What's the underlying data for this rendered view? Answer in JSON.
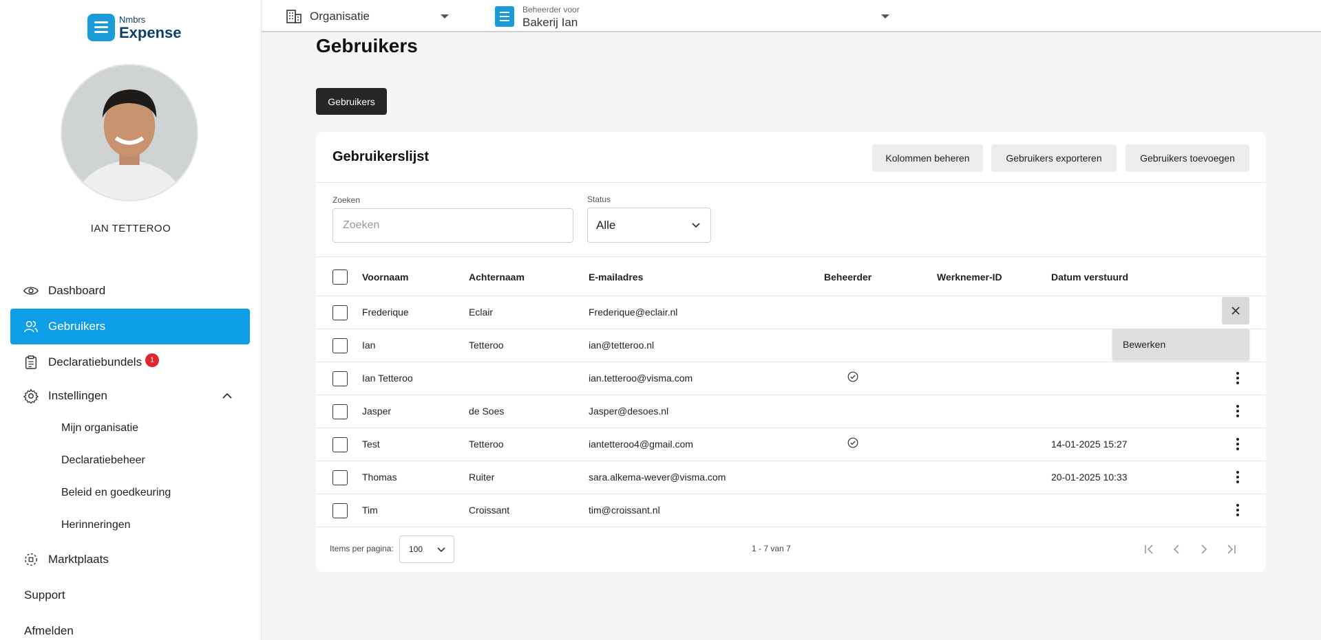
{
  "brand": {
    "line1": "Nmbrs",
    "line2": "Expense"
  },
  "user": {
    "name": "IAN TETTEROO"
  },
  "nav": {
    "items": [
      {
        "label": "Dashboard"
      },
      {
        "label": "Gebruikers"
      },
      {
        "label": "Declaratiebundels",
        "badge": "1"
      },
      {
        "label": "Instellingen"
      }
    ],
    "settings_sub": [
      "Mijn organisatie",
      "Declaratiebeheer",
      "Beleid en goedkeuring",
      "Herinneringen"
    ],
    "marketplace": "Marktplaats",
    "support": "Support",
    "logout": "Afmelden"
  },
  "topbar": {
    "org_label": "Organisatie",
    "admin_caption": "Beheerder voor",
    "admin_value": "Bakerij Ian"
  },
  "page": {
    "title": "Gebruikers",
    "tab": "Gebruikers"
  },
  "card": {
    "title": "Gebruikerslijst",
    "actions": [
      "Kolommen beheren",
      "Gebruikers exporteren",
      "Gebruikers toevoegen"
    ],
    "search_label": "Zoeken",
    "search_placeholder": "Zoeken",
    "status_label": "Status",
    "status_value": "Alle"
  },
  "table": {
    "columns": [
      "Voornaam",
      "Achternaam",
      "E-mailadres",
      "Beheerder",
      "Werknemer-ID",
      "Datum verstuurd"
    ],
    "rows": [
      {
        "first": "Frederique",
        "last": "Eclair",
        "email": "Frederique@eclair.nl",
        "admin": false,
        "emp": "",
        "date": ""
      },
      {
        "first": "Ian",
        "last": "Tetteroo",
        "email": "ian@tetteroo.nl",
        "admin": false,
        "emp": "",
        "date": ""
      },
      {
        "first": "Ian Tetteroo",
        "last": "",
        "email": "ian.tetteroo@visma.com",
        "admin": true,
        "emp": "",
        "date": ""
      },
      {
        "first": "Jasper",
        "last": "de Soes",
        "email": "Jasper@desoes.nl",
        "admin": false,
        "emp": "",
        "date": ""
      },
      {
        "first": "Test",
        "last": "Tetteroo",
        "email": "iantetteroo4@gmail.com",
        "admin": true,
        "emp": "",
        "date": "14-01-2025 15:27"
      },
      {
        "first": "Thomas",
        "last": "Ruiter",
        "email": "sara.alkema-wever@visma.com",
        "admin": false,
        "emp": "",
        "date": "20-01-2025 10:33"
      },
      {
        "first": "Tim",
        "last": "Croissant",
        "email": "tim@croissant.nl",
        "admin": false,
        "emp": "",
        "date": ""
      }
    ],
    "row_menu": {
      "edit_label": "Bewerken"
    }
  },
  "pagination": {
    "items_per_page_label": "Items per pagina:",
    "items_per_page": "100",
    "range": "1 - 7 van 7"
  },
  "colors": {
    "accent": "#0e9de7",
    "badge": "#e0262c",
    "dark_button": "#262626"
  }
}
